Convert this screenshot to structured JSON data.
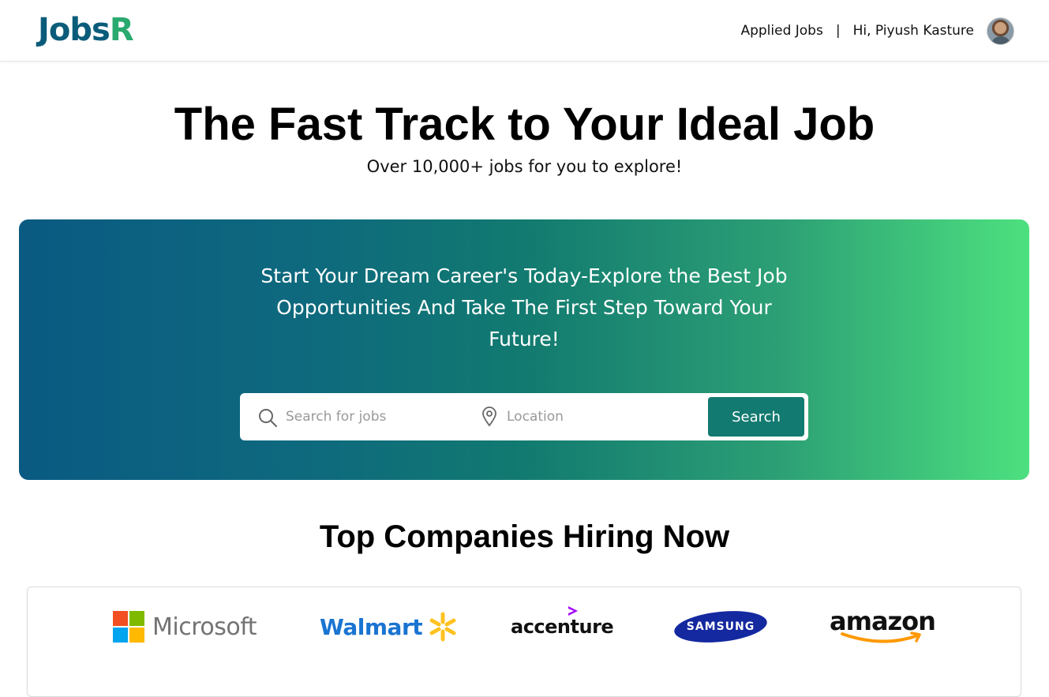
{
  "header": {
    "logo_part1": "Jobs",
    "logo_part2": "R",
    "applied_jobs": "Applied Jobs",
    "separator": "|",
    "greeting": "Hi, Piyush Kasture"
  },
  "hero": {
    "title": "The Fast Track to Your Ideal Job",
    "subtitle": "Over 10,000+ jobs for you to explore!"
  },
  "banner": {
    "tagline": "Start Your Dream Career's Today-Explore the Best Job Opportunities And Take The First Step Toward Your Future!",
    "search_placeholder": "Search for jobs",
    "location_placeholder": "Location",
    "search_button": "Search"
  },
  "companies": {
    "title": "Top Companies Hiring Now",
    "list": [
      {
        "name": "Microsoft"
      },
      {
        "name": "Walmart"
      },
      {
        "name": "accenture"
      },
      {
        "name": "SAMSUNG"
      },
      {
        "name": "amazon"
      }
    ]
  },
  "colors": {
    "brand_dark": "#0b5c7a",
    "brand_green": "#2aaa6e",
    "button": "#127a70",
    "gradient_start": "#0a5a82",
    "gradient_end": "#4de07f"
  },
  "icons": {
    "search": "search-icon",
    "location": "location-pin-icon",
    "avatar": "user-avatar"
  }
}
